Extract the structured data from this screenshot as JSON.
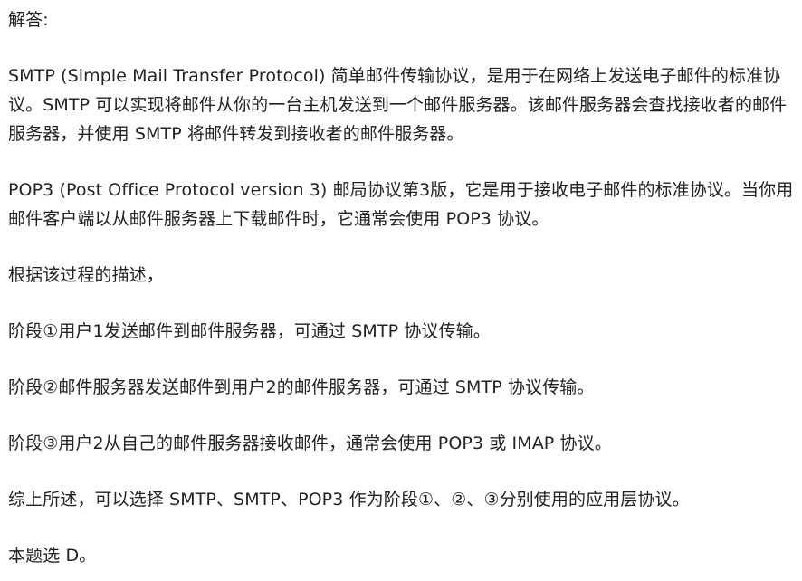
{
  "answer": {
    "heading": "解答:",
    "paragraphs": [
      "SMTP (Simple Mail Transfer Protocol) 简单邮件传输协议，是用于在网络上发送电子邮件的标准协议。SMTP 可以实现将邮件从你的一台主机发送到一个邮件服务器。该邮件服务器会查找接收者的邮件服务器，并使用 SMTP 将邮件转发到接收者的邮件服务器。",
      "POP3 (Post Office Protocol version 3) 邮局协议第3版，它是用于接收电子邮件的标准协议。当你用邮件客户端以从邮件服务器上下载邮件时，它通常会使用 POP3 协议。",
      "根据该过程的描述，",
      "阶段①用户1发送邮件到邮件服务器，可通过 SMTP 协议传输。",
      "阶段②邮件服务器发送邮件到用户2的邮件服务器，可通过 SMTP 协议传输。",
      "阶段③用户2从自己的邮件服务器接收邮件，通常会使用 POP3 或 IMAP 协议。",
      "综上所述，可以选择 SMTP、SMTP、POP3 作为阶段①、②、③分别使用的应用层协议。",
      "本题选 D。"
    ]
  }
}
